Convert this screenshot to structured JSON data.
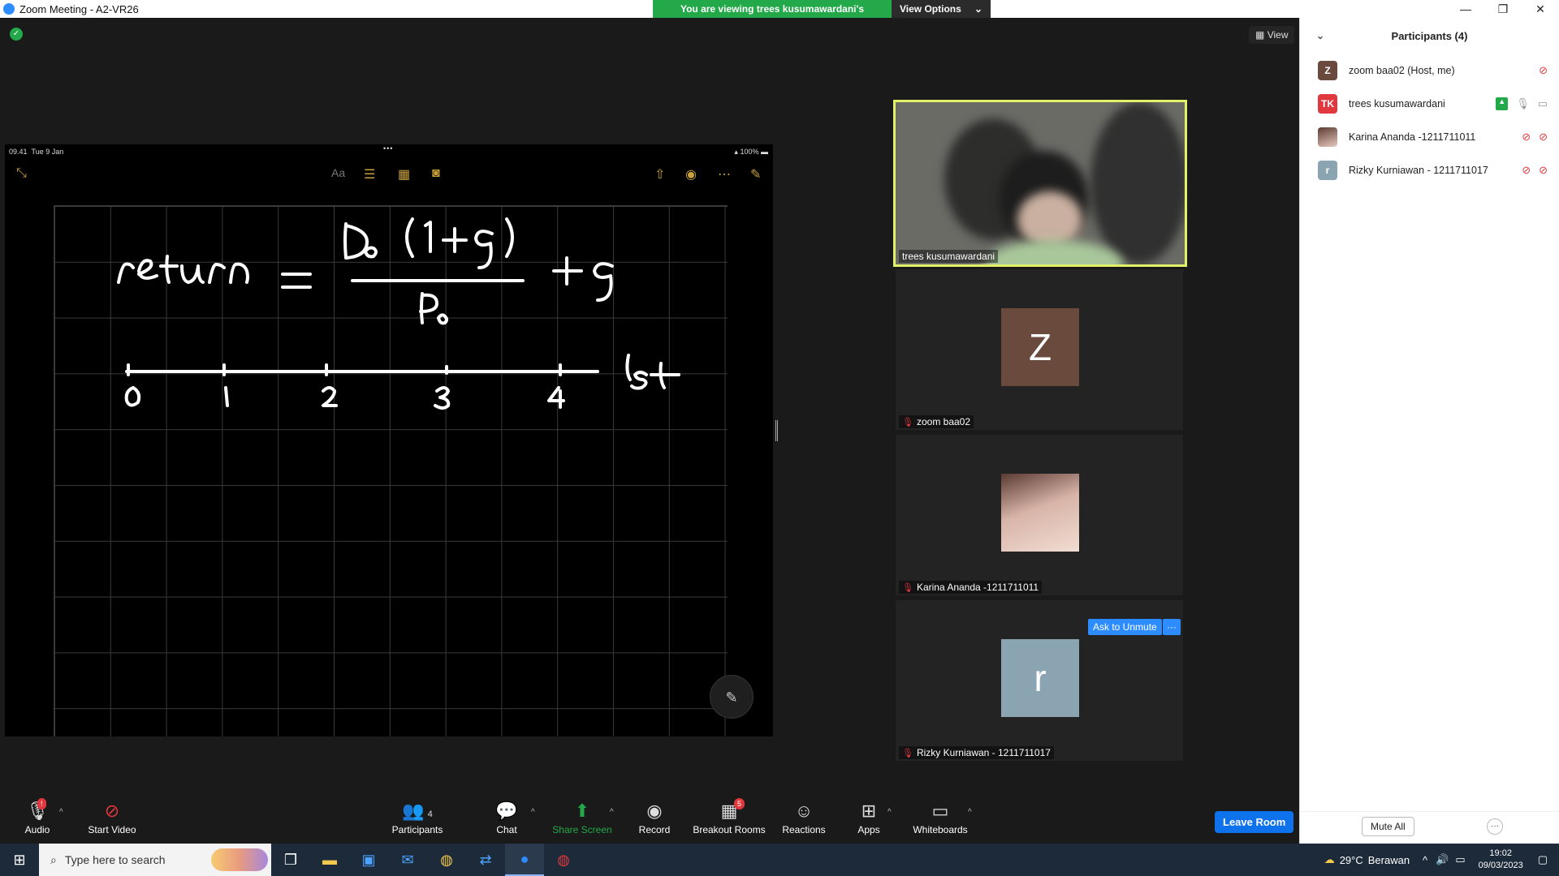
{
  "window": {
    "title": "Zoom Meeting - A2-VR26",
    "minimize": "—",
    "restore": "❐",
    "close": "✕"
  },
  "banner": {
    "message": "You are viewing trees kusumawardani's screen",
    "view_options": "View Options"
  },
  "view_button": "View",
  "shared_screen": {
    "status_time": "09.41",
    "status_date": "Tue 9 Jan",
    "battery": "100%",
    "dots": "•••",
    "toolbar_text": "Aa"
  },
  "tiles": {
    "active_name": "trees kusumawardani",
    "z_name": "zoom baa02",
    "z_initial": "Z",
    "karina_name": "Karina Ananda -1211711011",
    "rizky_name": "Rizky Kurniawan - 1211711017",
    "r_initial": "r",
    "ask_unmute": "Ask to Unmute",
    "more": "···"
  },
  "toolbar": {
    "audio": "Audio",
    "start_video": "Start Video",
    "participants": "Participants",
    "participants_count": "4",
    "chat": "Chat",
    "share_screen": "Share Screen",
    "record": "Record",
    "breakout_rooms": "Breakout Rooms",
    "breakout_count": "5",
    "reactions": "Reactions",
    "apps": "Apps",
    "whiteboards": "Whiteboards",
    "leave_room": "Leave Room",
    "audio_badge": "!"
  },
  "panel": {
    "title": "Participants (4)",
    "participants": [
      {
        "initials": "Z",
        "name": "zoom baa02 (Host, me)",
        "color": "#6b4a3e"
      },
      {
        "initials": "TK",
        "name": "trees kusumawardani",
        "color": "#e0383e"
      },
      {
        "initials": "",
        "name": "Karina Ananda -1211711011",
        "color": "#c9a79a"
      },
      {
        "initials": "r",
        "name": "Rizky Kurniawan - 1211711017",
        "color": "#8aa4b2"
      }
    ],
    "mute_all": "Mute All",
    "more": "···"
  },
  "taskbar": {
    "search_placeholder": "Type here to search",
    "temperature": "29°C",
    "weather": "Berawan",
    "time": "19:02",
    "date": "09/03/2023"
  },
  "colors": {
    "zoom_blue": "#2d8cff",
    "share_green": "#23a94a",
    "active_border": "#e2f06a",
    "mute_red": "#e0383e"
  }
}
